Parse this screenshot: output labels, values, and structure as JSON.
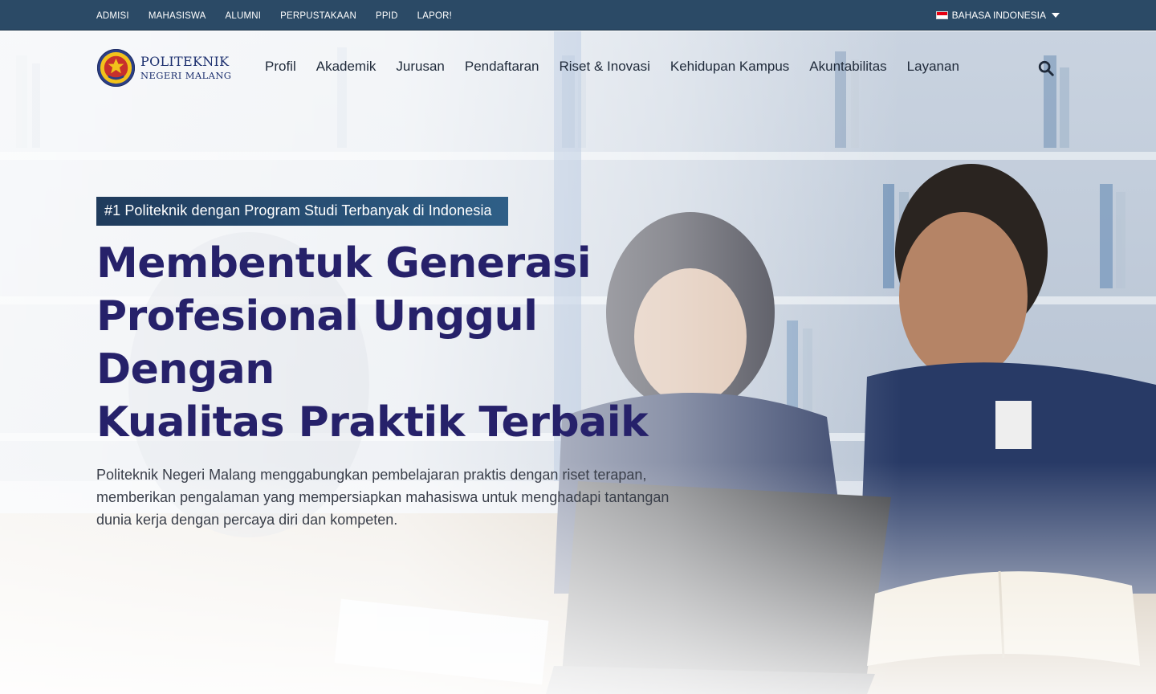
{
  "topbar": {
    "links": [
      "ADMISI",
      "MAHASISWA",
      "ALUMNI",
      "PERPUSTAKAAN",
      "PPID",
      "LAPOR!"
    ],
    "language": "BAHASA INDONESIA",
    "flag_icon": "indonesia-flag-icon"
  },
  "brand": {
    "line1": "POLITEKNIK",
    "line2": "NEGERI MALANG",
    "emblem_icon": "polinema-emblem-icon"
  },
  "nav": {
    "items": [
      "Profil",
      "Akademik",
      "Jurusan",
      "Pendaftaran",
      "Riset & Inovasi",
      "Kehidupan Kampus",
      "Akuntabilitas",
      "Layanan"
    ],
    "search_icon": "search-icon"
  },
  "hero": {
    "badge": "#1 Politeknik dengan Program Studi Terbanyak di Indonesia",
    "title_line1": "Membentuk Generasi",
    "title_line2": "Profesional Unggul Dengan",
    "title_line3": "Kualitas Praktik Terbaik",
    "description": "Politeknik Negeri Malang menggabungkan pembelajaran praktis dengan riset terapan, memberikan pengalaman yang mempersiapkan mahasiswa untuk menghadapi tantangan dunia kerja dengan percaya diri dan kompeten."
  },
  "colors": {
    "topbar_bg": "#2b4a66",
    "brand_text": "#1c2f6e",
    "hero_title": "#26216a",
    "badge_bg": "#1f3b5c"
  }
}
